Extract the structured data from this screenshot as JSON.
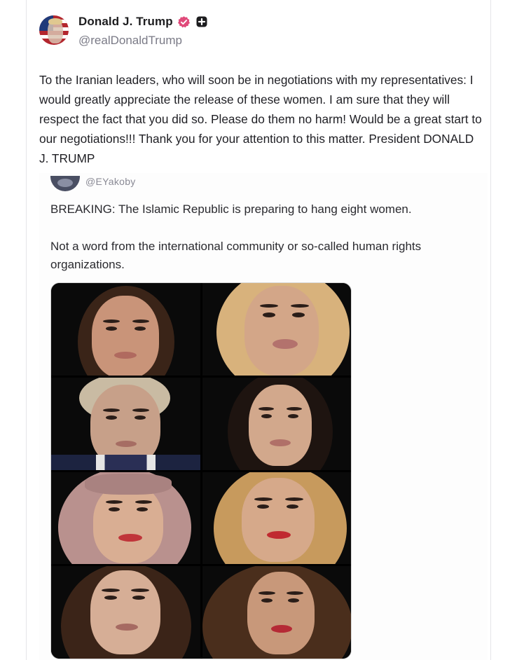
{
  "post": {
    "display_name": "Donald J. Trump",
    "handle": "@realDonaldTrump",
    "verified_icon": "verified-badge-icon",
    "plus_icon": "plus-badge-icon",
    "text": "To the Iranian leaders, who will soon be in negotiations with my representatives: I would greatly appreciate the release of these women. I am sure that they will respect the fact that you did so. Please do them no harm! Would be a great start to our negotiations!!! Thank you for your attention to this matter. President DONALD J. TRUMP",
    "colors": {
      "badge": "#e04a7a",
      "plus": "#1d1d1f"
    }
  },
  "embed": {
    "handle": "@EYakoby",
    "breaking": "BREAKING: The Islamic Republic is preparing to hang eight women.",
    "body": "Not a word from the international community or so-called human rights organizations.",
    "photos": [
      "portrait-1",
      "portrait-2",
      "portrait-3",
      "portrait-4",
      "portrait-5",
      "portrait-6",
      "portrait-7",
      "portrait-8"
    ]
  }
}
